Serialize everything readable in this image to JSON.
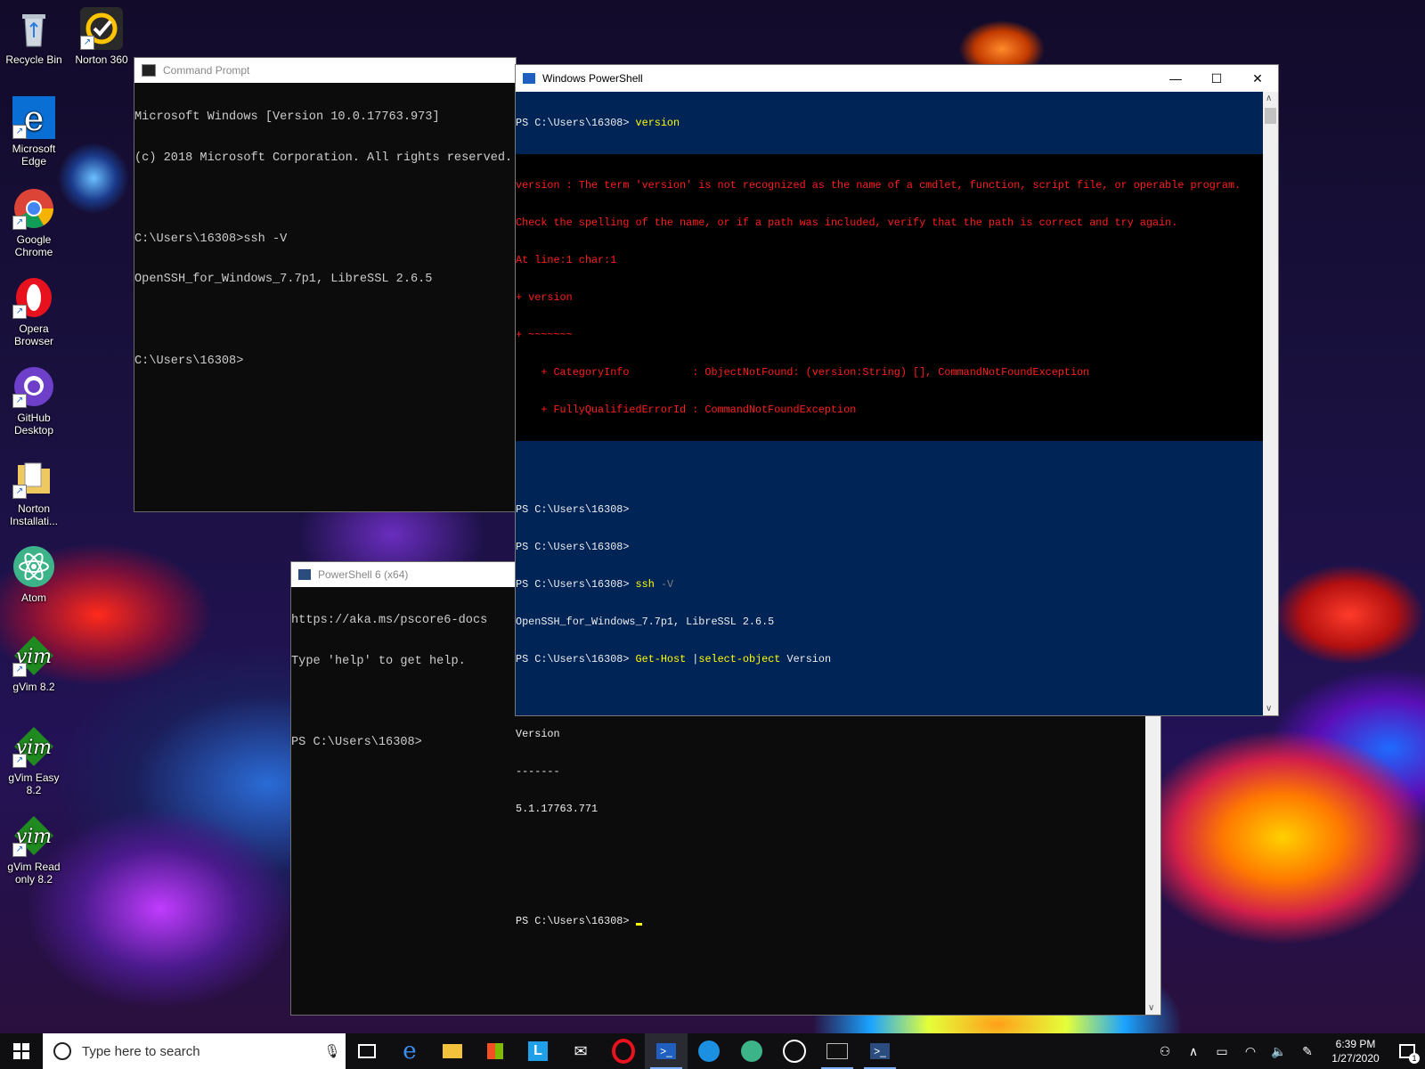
{
  "desktop": {
    "icons": [
      {
        "label": "Recycle Bin"
      },
      {
        "label": "Norton 360"
      },
      {
        "label": "Microsoft Edge"
      },
      {
        "label": "Google Chrome"
      },
      {
        "label": "Opera Browser"
      },
      {
        "label": "GitHub Desktop"
      },
      {
        "label": "Norton Installati..."
      },
      {
        "label": "Atom"
      },
      {
        "label": "gVim 8.2"
      },
      {
        "label": "gVim Easy 8.2"
      },
      {
        "label": "gVim Read only 8.2"
      }
    ]
  },
  "cmd_window": {
    "title": "Command Prompt",
    "lines": [
      "Microsoft Windows [Version 10.0.17763.973]",
      "(c) 2018 Microsoft Corporation. All rights reserved.",
      "",
      "C:\\Users\\16308>ssh -V",
      "OpenSSH_for_Windows_7.7p1, LibreSSL 2.6.5",
      "",
      "C:\\Users\\16308>"
    ]
  },
  "pwsh6_window": {
    "title": "PowerShell 6 (x64)",
    "lines": [
      "https://aka.ms/pscore6-docs",
      "Type 'help' to get help.",
      "",
      "PS C:\\Users\\16308>"
    ]
  },
  "ps_window": {
    "title": "Windows PowerShell",
    "controls": {
      "minimize": "—",
      "maximize": "☐",
      "close": "✕"
    },
    "prompt": "PS C:\\Users\\16308>",
    "cmd1": "version",
    "error_lines": [
      "version : The term 'version' is not recognized as the name of a cmdlet, function, script file, or operable program.",
      "Check the spelling of the name, or if a path was included, verify that the path is correct and try again.",
      "At line:1 char:1",
      "+ version",
      "+ ~~~~~~~",
      "    + CategoryInfo          : ObjectNotFound: (version:String) [], CommandNotFoundException",
      "    + FullyQualifiedErrorId : CommandNotFoundException"
    ],
    "cmd_ssh": "ssh",
    "cmd_ssh_arg": "-V",
    "ssh_output": "OpenSSH_for_Windows_7.7p1, LibreSSL 2.6.5",
    "cmd_gethost": "Get-Host",
    "cmd_pipe": "|",
    "cmd_select": "select-object",
    "cmd_select_arg": "Version",
    "output_header": "Version",
    "output_rule": "-------",
    "output_value": "5.1.17763.771"
  },
  "taskbar": {
    "search_placeholder": "Type here to search",
    "time": "6:39 PM",
    "date": "1/27/2020",
    "notification_count": "1"
  },
  "colors": {
    "ps_background": "#012456",
    "error_text": "#ff1e1e",
    "command_text": "#ffff00"
  }
}
